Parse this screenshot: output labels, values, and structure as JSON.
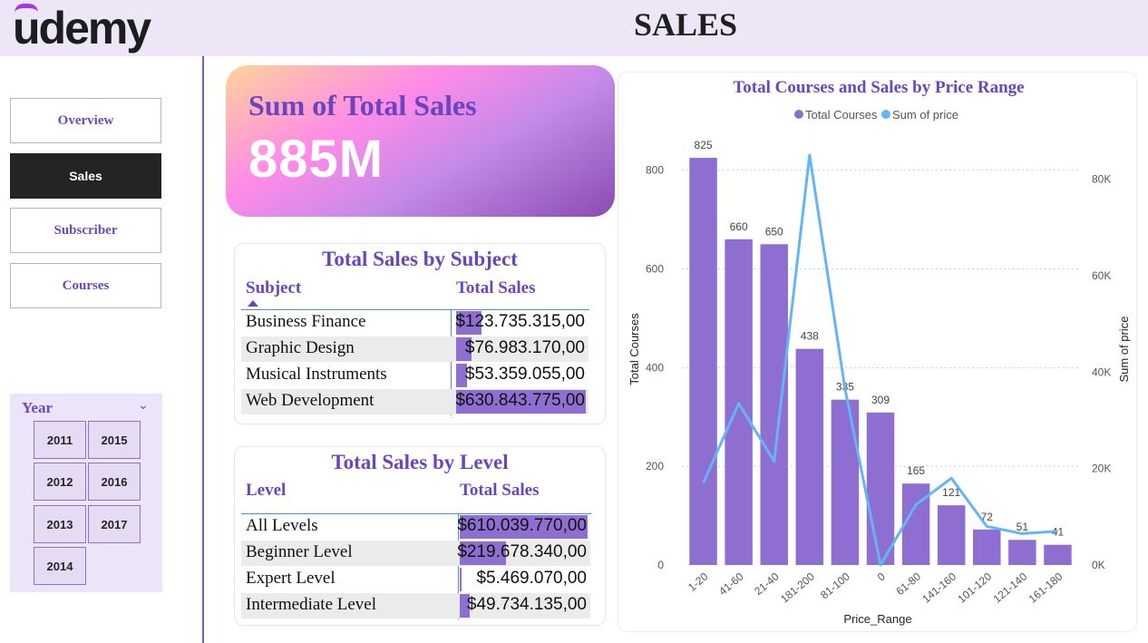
{
  "header": {
    "logo": "udemy",
    "title": "SALES"
  },
  "nav": [
    {
      "label": "Overview",
      "active": false
    },
    {
      "label": "Sales",
      "active": true
    },
    {
      "label": "Subscriber",
      "active": false
    },
    {
      "label": "Courses",
      "active": false
    }
  ],
  "slicer": {
    "title": "Year",
    "years": [
      "2011",
      "2015",
      "2012",
      "2016",
      "2013",
      "2017",
      "2014"
    ]
  },
  "kpi": {
    "label": "Sum of Total Sales",
    "value": "885M"
  },
  "subject_table": {
    "title": "Total Sales by Subject",
    "col_subject": "Subject",
    "col_sales": "Total Sales",
    "rows": [
      {
        "name": "Business Finance",
        "value": "$123.735.315,00",
        "amount": 123735315
      },
      {
        "name": "Graphic Design",
        "value": "$76.983.170,00",
        "amount": 76983170
      },
      {
        "name": "Musical Instruments",
        "value": "$53.359.055,00",
        "amount": 53359055
      },
      {
        "name": "Web Development",
        "value": "$630.843.775,00",
        "amount": 630843775
      }
    ]
  },
  "level_table": {
    "title": "Total Sales by Level",
    "col_level": "Level",
    "col_sales": "Total Sales",
    "rows": [
      {
        "name": "All Levels",
        "value": "$610.039.770,00",
        "amount": 610039770
      },
      {
        "name": "Beginner Level",
        "value": "$219.678.340,00",
        "amount": 219678340
      },
      {
        "name": "Expert Level",
        "value": "$5.469.070,00",
        "amount": 5469070
      },
      {
        "name": "Intermediate Level",
        "value": "$49.734.135,00",
        "amount": 49734135
      }
    ]
  },
  "colors": {
    "accent": "#6a45be",
    "bar": "#8f6ed1",
    "line": "#64b5f6"
  },
  "chart_data": {
    "type": "bar",
    "title": "Total Courses and Sales by Price Range",
    "xlabel": "Price_Range",
    "ylabel": "Total Courses",
    "y2label": "Sum of price",
    "legend": [
      "Total Courses",
      "Sum of price"
    ],
    "legend_position": "top-center",
    "categories": [
      "1-20",
      "41-60",
      "21-40",
      "181-200",
      "81-100",
      "0",
      "61-80",
      "141-160",
      "101-120",
      "121-140",
      "161-180"
    ],
    "series": [
      {
        "name": "Total Courses",
        "type": "bar",
        "axis": "left",
        "values": [
          825,
          660,
          650,
          438,
          335,
          309,
          165,
          121,
          72,
          51,
          41
        ]
      },
      {
        "name": "Sum of price",
        "type": "line",
        "axis": "right",
        "values": [
          17000,
          33500,
          21500,
          85000,
          36500,
          0,
          12500,
          18000,
          8000,
          6500,
          7000
        ]
      }
    ],
    "y_ticks": [
      "0",
      "200",
      "400",
      "600",
      "800"
    ],
    "y2_ticks": [
      "0K",
      "20K",
      "40K",
      "60K",
      "80K"
    ],
    "ylim": [
      0,
      860
    ],
    "y2lim": [
      0,
      88000
    ]
  }
}
